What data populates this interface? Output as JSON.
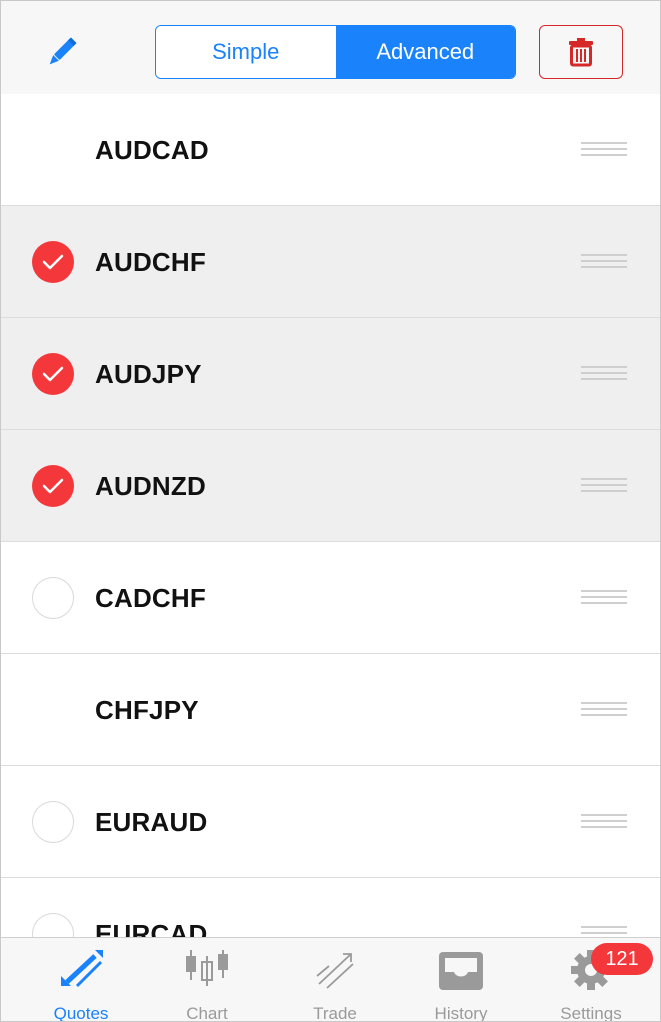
{
  "toolbar": {
    "segments": {
      "simple": "Simple",
      "advanced": "Advanced",
      "selected": "Advanced"
    },
    "edit_icon": "pencil-icon",
    "delete_icon": "trash-icon",
    "accent_color": "#1a82fb",
    "delete_color": "#d72828"
  },
  "symbols": [
    {
      "name": "AUDCAD",
      "check": "none"
    },
    {
      "name": "AUDCHF",
      "check": "on"
    },
    {
      "name": "AUDJPY",
      "check": "on"
    },
    {
      "name": "AUDNZD",
      "check": "on"
    },
    {
      "name": "CADCHF",
      "check": "off"
    },
    {
      "name": "CHFJPY",
      "check": "none"
    },
    {
      "name": "EURAUD",
      "check": "off"
    },
    {
      "name": "EURCAD",
      "check": "off"
    }
  ],
  "tabs": [
    {
      "label": "Quotes",
      "icon": "quotes-icon",
      "active": true
    },
    {
      "label": "Chart",
      "icon": "chart-icon",
      "active": false
    },
    {
      "label": "Trade",
      "icon": "trade-icon",
      "active": false
    },
    {
      "label": "History",
      "icon": "history-icon",
      "active": false
    },
    {
      "label": "Settings",
      "icon": "settings-icon",
      "active": false
    }
  ],
  "settings_badge": "121",
  "check_color": "#f4373b"
}
